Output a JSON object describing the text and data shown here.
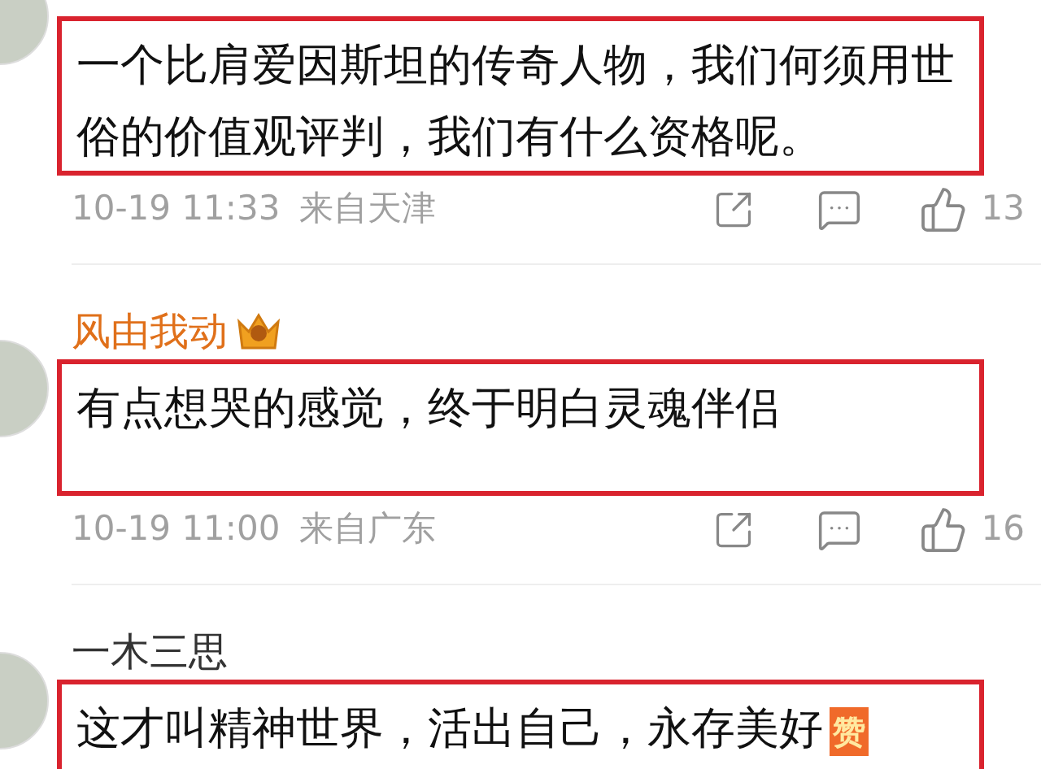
{
  "comments": [
    {
      "text": "一个比肩爱因斯坦的传奇人物，我们何须用世俗的价值观评判，我们有什么资格呢。",
      "highlighted": true,
      "time": "10-19 11:33",
      "location": "来自天津",
      "likes": "13"
    },
    {
      "username": "风由我动",
      "vip": true,
      "text": "有点想哭的感觉，终于明白灵魂伴侣",
      "highlighted": true,
      "time": "10-19 11:00",
      "location": "来自广东",
      "likes": "16"
    },
    {
      "username": "一木三思",
      "vip": false,
      "text": "这才叫精神世界，活出自己，永存美好",
      "emoji": "赞",
      "highlighted": true
    }
  ]
}
